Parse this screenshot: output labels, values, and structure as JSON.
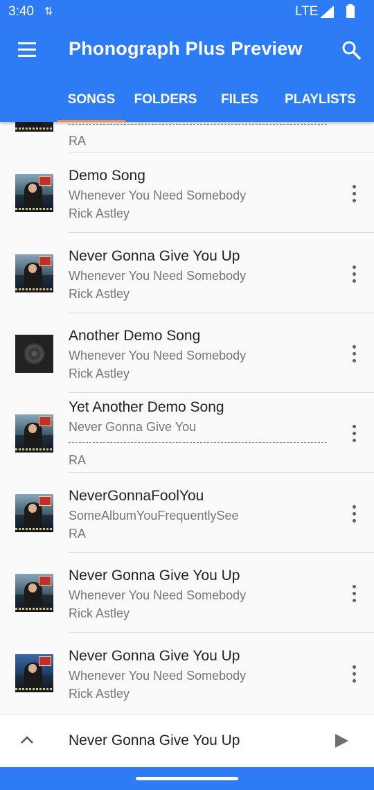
{
  "status_bar": {
    "time": "3:40",
    "network": "LTE"
  },
  "app_bar": {
    "title": "Phonograph Plus Preview"
  },
  "tabs": [
    {
      "label": "SONGS",
      "selected": true
    },
    {
      "label": "FOLDERS",
      "selected": false
    },
    {
      "label": "FILES",
      "selected": false
    },
    {
      "label": "PLAYLISTS",
      "selected": false
    }
  ],
  "songs": [
    {
      "title": "",
      "album": "",
      "artist": "RA",
      "art": "album-cover"
    },
    {
      "title": "Demo Song",
      "album": "Whenever You Need Somebody",
      "artist": "Rick Astley",
      "art": "album-cover"
    },
    {
      "title": "Never Gonna Give You Up",
      "album": "Whenever You Need Somebody",
      "artist": "Rick Astley",
      "art": "album-cover"
    },
    {
      "title": "Another Demo Song",
      "album": "Whenever You Need Somebody",
      "artist": "Rick Astley",
      "art": "vinyl-disc"
    },
    {
      "title": "Yet Another Demo Song",
      "album": "Never Gonna Give You",
      "artist": "RA",
      "art": "album-cover"
    },
    {
      "title": "NeverGonnaFoolYou",
      "album": "SomeAlbumYouFrequentlySee",
      "artist": "RA",
      "art": "album-cover"
    },
    {
      "title": "Never Gonna Give You Up",
      "album": "Whenever You Need Somebody",
      "artist": "Rick Astley",
      "art": "album-cover"
    },
    {
      "title": "Never Gonna Give You Up",
      "album": "Whenever You Need Somebody",
      "artist": "Rick Astley",
      "art": "album-cover"
    }
  ],
  "mini_player": {
    "title": "Never Gonna Give You Up"
  },
  "colors": {
    "primary": "#2e7bf6",
    "accent": "#ff8a3d"
  },
  "icons": [
    "menu-icon",
    "search-icon",
    "more-vert-icon",
    "expand-less-icon",
    "play-icon",
    "sync-icon",
    "signal-icon",
    "battery-icon"
  ]
}
